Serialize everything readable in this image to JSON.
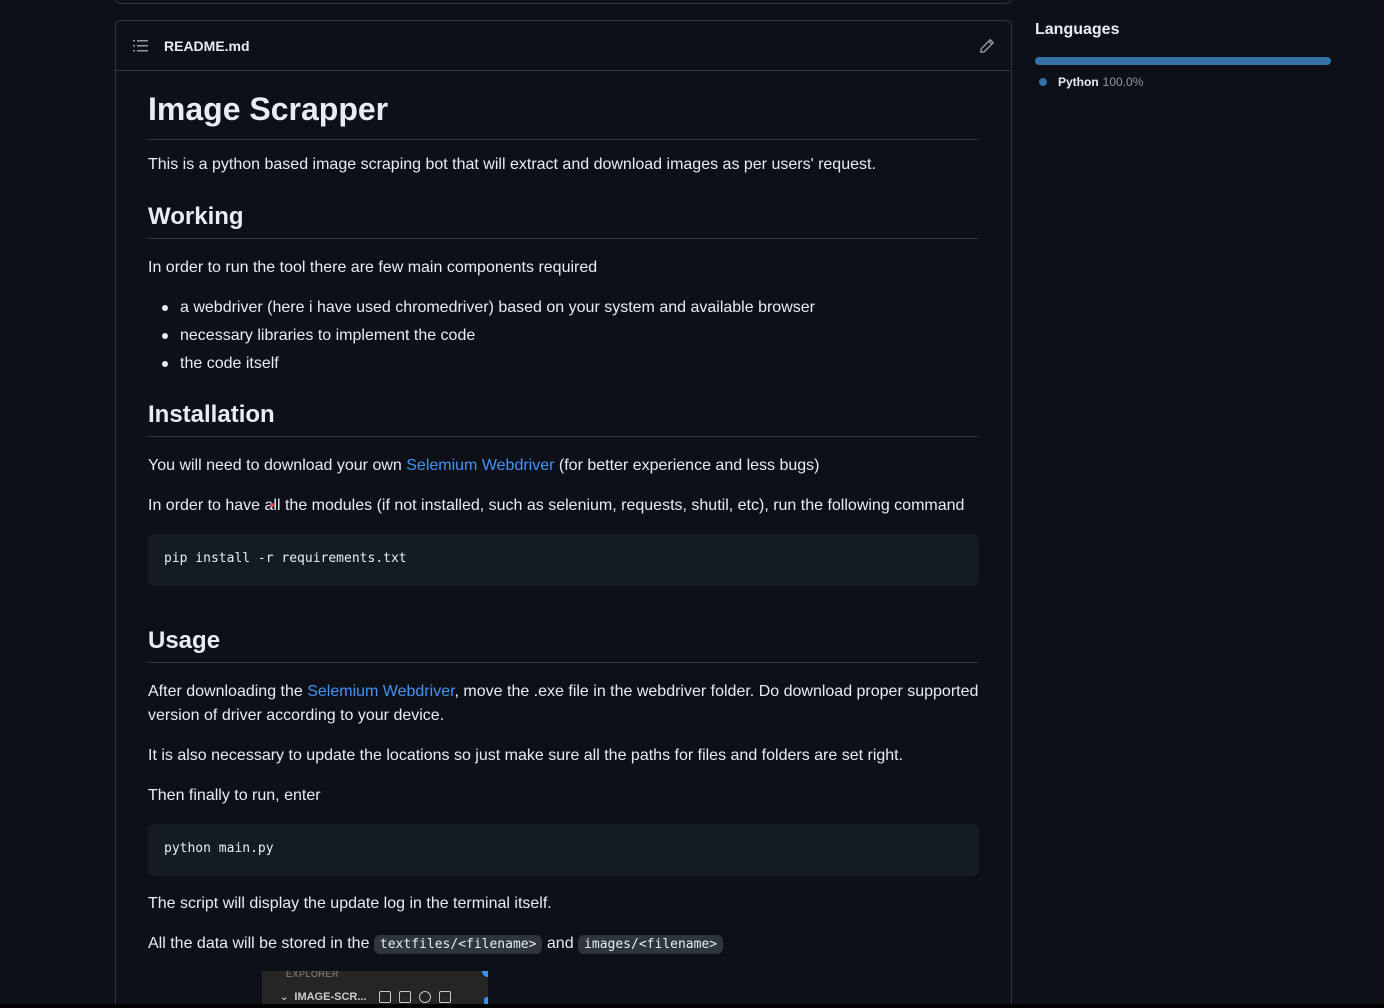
{
  "readme": {
    "filename": "README.md",
    "title": "Image Scrapper",
    "intro": "This is a python based image scraping bot that will extract and download images as per users' request.",
    "working": {
      "heading": "Working",
      "text": "In order to run the tool there are few main components required",
      "items": [
        "a webdriver (here i have used chromedriver) based on your system and available browser",
        "necessary libraries to implement the code",
        "the code itself"
      ]
    },
    "installation": {
      "heading": "Installation",
      "p1_before": "You will need to download your own ",
      "p1_link": "Selemium Webdriver",
      "p1_after": " (for better experience and less bugs)",
      "p2": "In order to have all the modules (if not installed, such as selenium, requests, shutil, etc), run the following command",
      "code": "pip install -r requirements.txt"
    },
    "usage": {
      "heading": "Usage",
      "p1_before": "After downloading the ",
      "p1_link": "Selemium Webdriver",
      "p1_after": ", move the .exe file in the webdriver folder. Do download proper supported version of driver according to your device.",
      "p2": "It is also necessary to update the locations so just make sure all the paths for files and folders are set right.",
      "p3": "Then finally to run, enter",
      "code": "python main.py",
      "p4": "The script will display the update log in the terminal itself.",
      "p5_before": "All the data will be stored in the ",
      "p5_code1": "textfiles/<filename>",
      "p5_mid": " and ",
      "p5_code2": "images/<filename>"
    },
    "embedded_image": {
      "explorer_label": "EXPLORER",
      "folder_label": "IMAGE-SCR..."
    }
  },
  "languages": {
    "heading": "Languages",
    "items": [
      {
        "name": "Python",
        "percent": "100.0%",
        "fraction": 1.0,
        "color": "#3572a5"
      }
    ]
  },
  "colors": {
    "background": "#0d1117",
    "border": "#30363d",
    "link": "#4493f8",
    "code_bg": "#151b23"
  }
}
